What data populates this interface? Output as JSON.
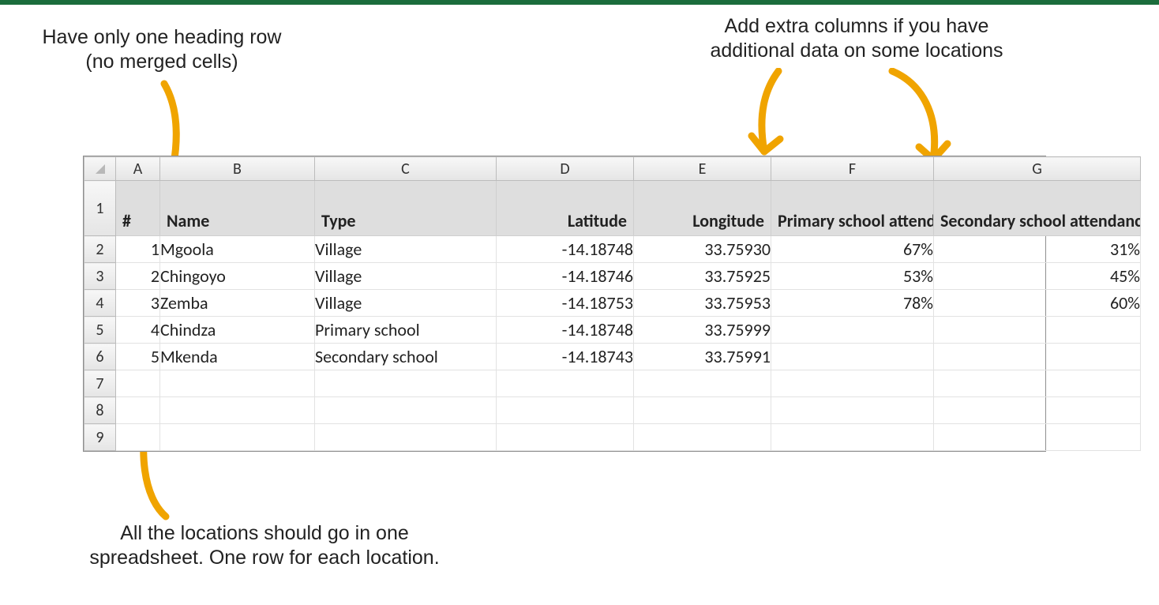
{
  "annotations": {
    "top_left": "Have only one heading row\n(no merged cells)",
    "top_right": "Add extra columns if you have\nadditional data on some locations",
    "bottom": "All the locations should go in one\nspreadsheet. One row for each location."
  },
  "spreadsheet": {
    "column_letters": [
      "A",
      "B",
      "C",
      "D",
      "E",
      "F",
      "G"
    ],
    "row_numbers": [
      "1",
      "2",
      "3",
      "4",
      "5",
      "6",
      "7",
      "8",
      "9"
    ],
    "headers": {
      "A": "#",
      "B": "Name",
      "C": "Type",
      "D": "Latitude",
      "E": "Longitude",
      "F": "Primary school attendance",
      "G": "Secondary school attendance"
    },
    "rows": [
      {
        "n": "1",
        "name": "Mgoola",
        "type": "Village",
        "lat": "-14.18748",
        "lon": "33.75930",
        "pri": "67%",
        "sec": "31%"
      },
      {
        "n": "2",
        "name": "Chingoyo",
        "type": "Village",
        "lat": "-14.18746",
        "lon": "33.75925",
        "pri": "53%",
        "sec": "45%"
      },
      {
        "n": "3",
        "name": "Zemba",
        "type": "Village",
        "lat": "-14.18753",
        "lon": "33.75953",
        "pri": "78%",
        "sec": "60%"
      },
      {
        "n": "4",
        "name": "Chindza",
        "type": "Primary school",
        "lat": "-14.18748",
        "lon": "33.75999",
        "pri": "",
        "sec": ""
      },
      {
        "n": "5",
        "name": "Mkenda",
        "type": "Secondary school",
        "lat": "-14.18743",
        "lon": "33.75991",
        "pri": "",
        "sec": ""
      }
    ],
    "empty_rows": 3
  },
  "colors": {
    "accent_green": "#1b6d3c",
    "arrow": "#f0a400",
    "grid_header_bg": "#e8e8e8",
    "heading_row_bg": "#dedede"
  }
}
